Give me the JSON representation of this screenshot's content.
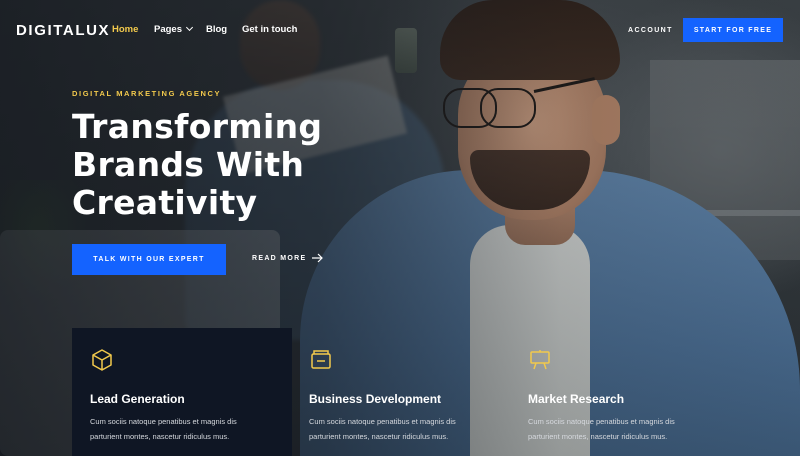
{
  "nav": {
    "logo": "DIGITALUX",
    "links": [
      {
        "label": "Home",
        "active": true
      },
      {
        "label": "Pages",
        "active": false
      },
      {
        "label": "Blog",
        "active": false
      },
      {
        "label": "Get in touch",
        "active": false
      }
    ],
    "account_label": "ACCOUNT",
    "start_button": "START FOR FREE"
  },
  "hero": {
    "eyebrow": "DIGITAL MARKETING AGENCY",
    "headline": [
      "Transforming",
      "Brands With",
      "Creativity"
    ],
    "cta_button": "TALK WITH OUR EXPERT",
    "read_more": "READ MORE"
  },
  "services": [
    {
      "icon": "cube-icon",
      "title": "Lead Generation",
      "desc": [
        "Cum sociis natoque penatibus et magnis dis",
        "parturient montes, nascetur ridiculus mus."
      ]
    },
    {
      "icon": "wallet-icon",
      "title": "Business Development",
      "desc": [
        "Cum sociis natoque penatibus et magnis dis",
        "parturient montes, nascetur ridiculus mus."
      ]
    },
    {
      "icon": "easel-icon",
      "title": "Market Research",
      "desc": [
        "Cum sociis natoque penatibus et magnis dis",
        "parturient montes, nascetur ridiculus mus."
      ]
    }
  ],
  "colors": {
    "accent": "#f2c94c",
    "primary": "#1463ff",
    "card_dark": "#0f1624"
  }
}
